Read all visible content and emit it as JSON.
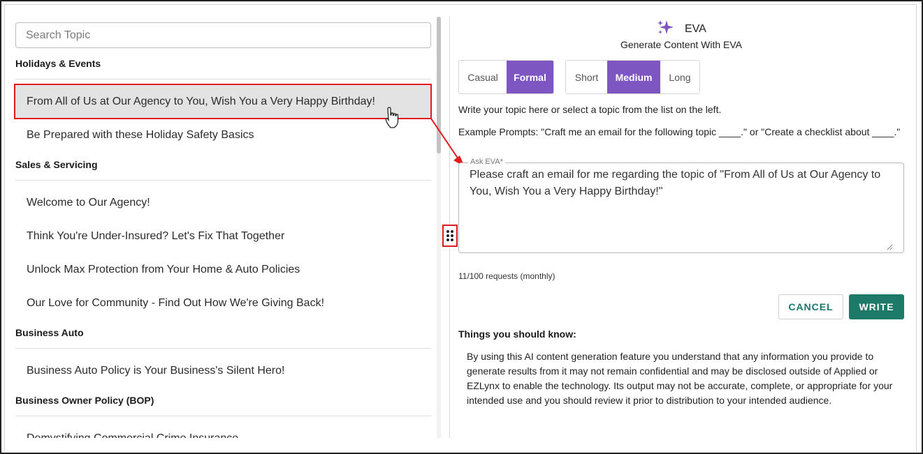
{
  "search": {
    "placeholder": "Search Topic"
  },
  "categories": [
    {
      "name": "Holidays & Events",
      "topics": [
        "From All of Us at Our Agency to You, Wish You a Very Happy Birthday!",
        "Be Prepared with these Holiday Safety Basics"
      ]
    },
    {
      "name": "Sales & Servicing",
      "topics": [
        "Welcome to Our Agency!",
        "Think You're Under-Insured? Let's Fix That Together",
        "Unlock Max Protection from Your Home & Auto Policies",
        "Our Love for Community - Find Out How We're Giving Back!"
      ]
    },
    {
      "name": "Business Auto",
      "topics": [
        "Business Auto Policy is Your Business's Silent Hero!"
      ]
    },
    {
      "name": "Business Owner Policy (BOP)",
      "topics": [
        "Demystifying Commercial Crime Insurance"
      ]
    }
  ],
  "eva": {
    "title": "EVA",
    "subtitle": "Generate Content With EVA",
    "tone_options": [
      "Casual",
      "Formal"
    ],
    "tone_selected": "Formal",
    "length_options": [
      "Short",
      "Medium",
      "Long"
    ],
    "length_selected": "Medium",
    "instruction": "Write your topic here or select a topic from the list on the left.",
    "example_prompts": "Example Prompts: \"Craft me an email for the following topic ____.\" or \"Create a checklist about ____.\"",
    "ask_label": "Ask EVA*",
    "ask_value": "Please craft an email for me regarding the topic of \"From All of Us at Our Agency to You, Wish You a Very Happy Birthday!\"",
    "requests": "11/100 requests (monthly)",
    "cancel_label": "CANCEL",
    "write_label": "WRITE",
    "notice_title": "Things you should know:",
    "notice_text": "By using this AI content generation feature you understand that any information you provide to generate results from it may not remain confidential and may be disclosed outside of Applied or EZLynx to enable the technology. Its output may not be accurate, complete, or appropriate for your intended use and you should review it prior to distribution to your intended audience."
  },
  "colors": {
    "accent_purple": "#7e56c2",
    "primary_green": "#1d7a69",
    "highlight_red": "#e01b1b",
    "selected_bg": "#e3e3e3"
  },
  "icons": [
    "sparkle-icon",
    "drag-handle-icon",
    "pointer-hand-icon",
    "resize-grip-icon"
  ]
}
